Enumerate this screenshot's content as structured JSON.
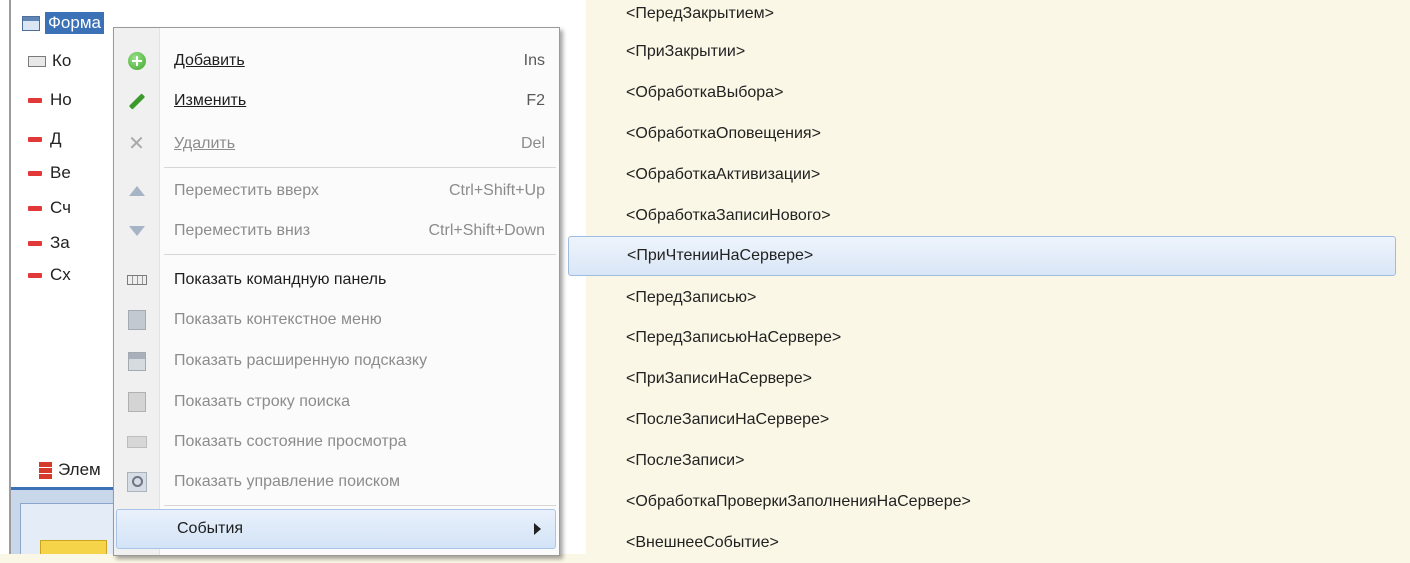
{
  "tree": {
    "root_label": "Форма",
    "children": [
      "Ко",
      "Но",
      "Д",
      "Ве",
      "Сч",
      "За",
      "Сх"
    ],
    "bottom_label": "Элем"
  },
  "menu": {
    "items": [
      {
        "label": "Добавить",
        "shortcut": "Ins",
        "icon": "add-icon",
        "disabled": false
      },
      {
        "label": "Изменить",
        "shortcut": "F2",
        "icon": "edit-icon",
        "disabled": false
      },
      {
        "label": "Удалить",
        "shortcut": "Del",
        "icon": "delete-icon",
        "disabled": true
      },
      {
        "label": "Переместить вверх",
        "shortcut": "Ctrl+Shift+Up",
        "icon": "move-up-icon",
        "disabled": true
      },
      {
        "label": "Переместить вниз",
        "shortcut": "Ctrl+Shift+Down",
        "icon": "move-down-icon",
        "disabled": true
      },
      {
        "label": "Показать командную панель",
        "shortcut": "",
        "icon": "command-panel-icon",
        "disabled": false
      },
      {
        "label": "Показать контекстное меню",
        "shortcut": "",
        "icon": "context-menu-icon",
        "disabled": true
      },
      {
        "label": "Показать расширенную подсказку",
        "shortcut": "",
        "icon": "extended-tooltip-icon",
        "disabled": true
      },
      {
        "label": "Показать строку поиска",
        "shortcut": "",
        "icon": "search-line-icon",
        "disabled": true
      },
      {
        "label": "Показать состояние просмотра",
        "shortcut": "",
        "icon": "view-state-icon",
        "disabled": true
      },
      {
        "label": "Показать управление поиском",
        "shortcut": "",
        "icon": "search-control-icon",
        "disabled": true
      },
      {
        "label": "События",
        "shortcut": "",
        "icon": "",
        "disabled": false,
        "submenu": true
      }
    ]
  },
  "events": {
    "items": [
      "<ПередЗакрытием>",
      "<ПриЗакрытии>",
      "<ОбработкаВыбора>",
      "<ОбработкаОповещения>",
      "<ОбработкаАктивизации>",
      "<ОбработкаЗаписиНового>",
      "<ПриЧтенииНаСервере>",
      "<ПередЗаписью>",
      "<ПередЗаписьюНаСервере>",
      "<ПриЗаписиНаСервере>",
      "<ПослеЗаписиНаСервере>",
      "<ПослеЗаписи>",
      "<ОбработкаПроверкиЗаполненияНаСервере>",
      "<ВнешнееСобытие>"
    ],
    "highlighted": "<ПриЧтенииНаСервере>"
  }
}
